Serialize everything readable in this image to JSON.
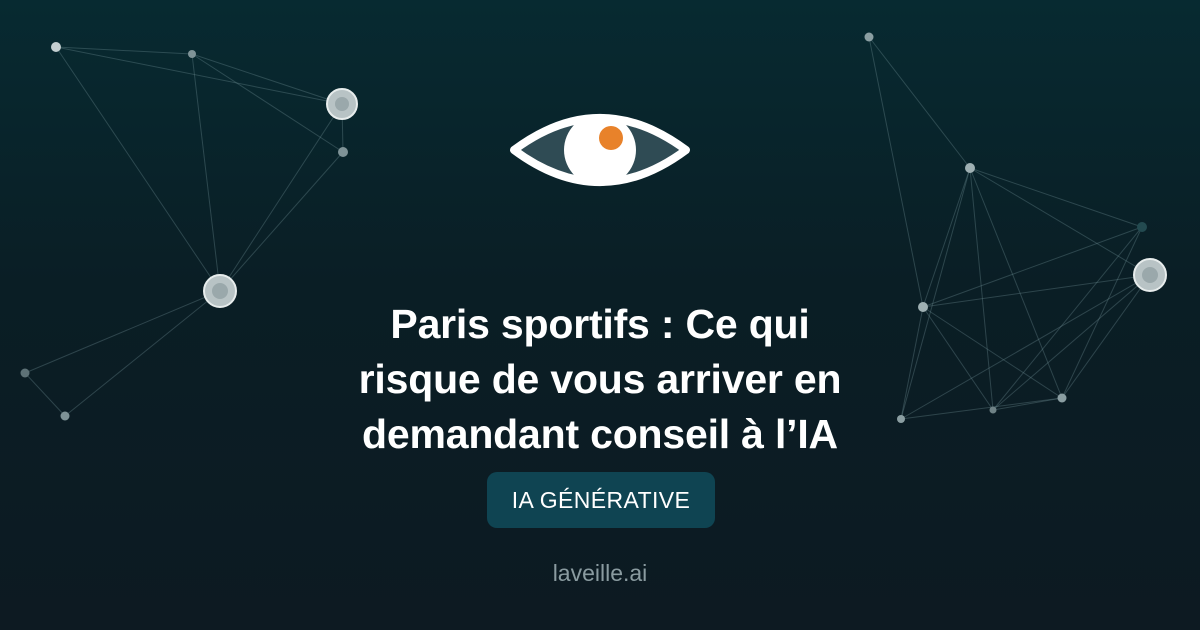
{
  "headline": {
    "line1": "Paris sportifs : Ce qui",
    "line2": "risque de vous arriver en",
    "line3": "demandant conseil à l’IA"
  },
  "category_tag": "IA GÉNÉRATIVE",
  "site_name": "laveille.ai",
  "icons": {
    "logo": "eye-icon",
    "decoration": "network-graph"
  },
  "colors": {
    "background_top": "#072a31",
    "background_bottom": "#0d1a22",
    "tag_background": "#0f4452",
    "eye_pupil_accent": "#e8822a",
    "text_primary": "#ffffff",
    "text_muted": "#8a9ba0"
  }
}
